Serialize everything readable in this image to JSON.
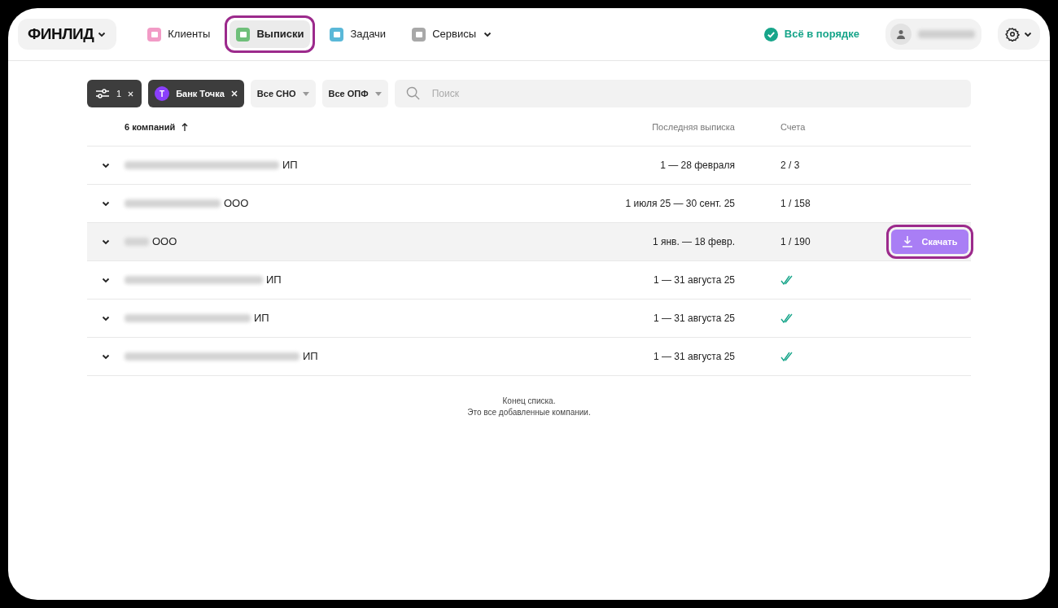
{
  "logo": "ФИНЛИД",
  "nav": [
    {
      "label": "Клиенты",
      "color": "#f29bc6",
      "selected": false,
      "highlighted": false,
      "dropdown": false
    },
    {
      "label": "Выписки",
      "color": "#6fbf7a",
      "selected": true,
      "highlighted": true,
      "dropdown": false
    },
    {
      "label": "Задачи",
      "color": "#5ab8d8",
      "selected": false,
      "highlighted": false,
      "dropdown": false
    },
    {
      "label": "Сервисы",
      "color": "#a8a8a8",
      "selected": false,
      "highlighted": false,
      "dropdown": true
    }
  ],
  "status": "Всё в порядке",
  "filters": {
    "settings_count": "1",
    "bank": {
      "letter": "Т",
      "label": "Банк Точка"
    },
    "selects": [
      "Все СНО",
      "Все ОПФ"
    ],
    "search": {
      "placeholder": "Поиск"
    }
  },
  "table": {
    "columns": [
      "6 компаний",
      "Последняя выписка",
      "Счета"
    ],
    "rows": [
      {
        "form": "ИП",
        "period": "1 — 28 февраля",
        "kind": "count",
        "accounts": "2 / 3",
        "hovered": false
      },
      {
        "form": "ООО",
        "period": "1 июля 25 — 30 сент. 25",
        "kind": "count",
        "accounts": "1 / 158",
        "hovered": false
      },
      {
        "form": "ООО",
        "period": "1 янв. — 18 февр.",
        "kind": "count",
        "accounts": "1 / 190",
        "hovered": true,
        "action": "Скачать",
        "action_highlighted": true
      },
      {
        "form": "ИП",
        "period": "1 — 31 августа 25",
        "kind": "done",
        "hovered": false
      },
      {
        "form": "ИП",
        "period": "1 — 31 августа 25",
        "kind": "done",
        "hovered": false
      },
      {
        "form": "ИП",
        "period": "1 — 31 августа 25",
        "kind": "done",
        "hovered": false
      }
    ]
  },
  "end_note": [
    "Конец списка.",
    "Это все добавленные компании."
  ]
}
